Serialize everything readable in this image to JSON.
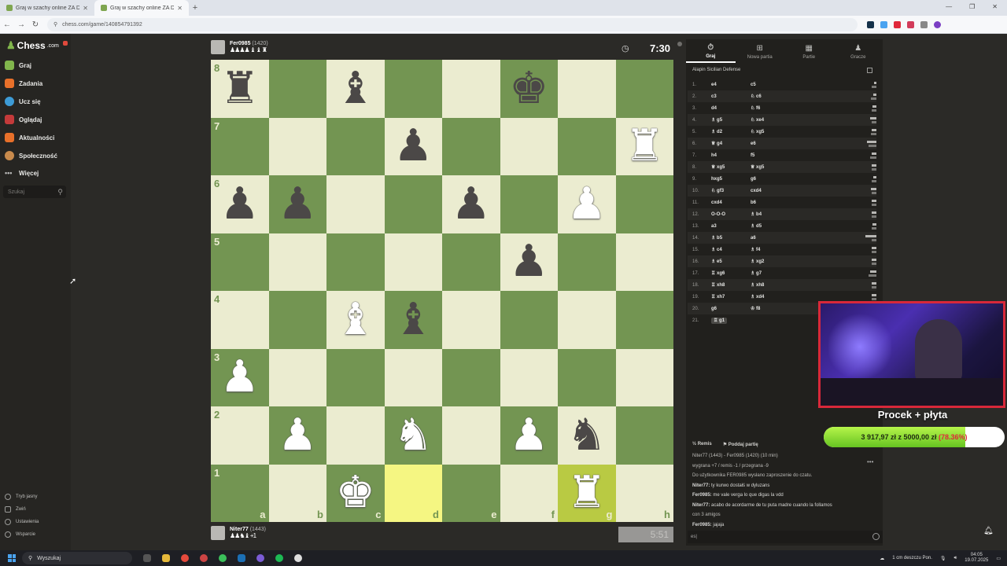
{
  "browser": {
    "tabs": [
      {
        "label": "Graj w szachy online ZA DARMO",
        "active": false
      },
      {
        "label": "Graj w szachy online ZA DARMO",
        "active": true
      }
    ],
    "url": "chess.com/game/140854791392"
  },
  "sidebar": {
    "logo": "Chess",
    "logo_domain": ".com",
    "items": [
      {
        "label": "Graj",
        "icon": "pawn-play-icon",
        "color": "#81b64c"
      },
      {
        "label": "Zadania",
        "icon": "puzzle-icon",
        "color": "#e8702a"
      },
      {
        "label": "Ucz się",
        "icon": "learn-icon",
        "color": "#3d9bd6"
      },
      {
        "label": "Oglądaj",
        "icon": "watch-icon",
        "color": "#c43a3a"
      },
      {
        "label": "Aktualności",
        "icon": "news-icon",
        "color": "#e8702a"
      },
      {
        "label": "Społeczność",
        "icon": "community-icon",
        "color": "#c88a4c"
      },
      {
        "label": "Więcej",
        "icon": "more-icon",
        "color": "#9a9a98"
      }
    ],
    "search_placeholder": "Szukaj",
    "bottom": [
      {
        "label": "Tryb jasny"
      },
      {
        "label": "Zwiń"
      },
      {
        "label": "Ustawienia"
      },
      {
        "label": "Wsparcie"
      }
    ]
  },
  "top_player": {
    "name": "Fer0985",
    "rating": "(1420)",
    "captured": "♟♟♟♟ ♝ ♝ ♜",
    "clock": "7:30"
  },
  "bottom_player": {
    "name": "Niter77",
    "rating": "(1443)",
    "captured": "♟♟♞♝ +1",
    "clock": "5:51"
  },
  "board": {
    "ranks": [
      "8",
      "7",
      "6",
      "5",
      "4",
      "3",
      "2",
      "1"
    ],
    "files": [
      "a",
      "b",
      "c",
      "d",
      "e",
      "f",
      "g",
      "h"
    ],
    "highlight": [
      "d1",
      "g1"
    ],
    "position": [
      [
        "br",
        "",
        "bb",
        "",
        "",
        "bk",
        "",
        ""
      ],
      [
        "",
        "",
        "",
        "bp",
        "",
        "",
        "",
        "wr"
      ],
      [
        "bp",
        "bp",
        "",
        "",
        "bp",
        "",
        "wp",
        ""
      ],
      [
        "",
        "",
        "",
        "",
        "",
        "bp",
        "",
        ""
      ],
      [
        "",
        "",
        "wb",
        "bb",
        "",
        "",
        "",
        ""
      ],
      [
        "wp",
        "",
        "",
        "",
        "",
        "",
        "",
        ""
      ],
      [
        "",
        "wp",
        "",
        "wn",
        "",
        "wp",
        "bn",
        ""
      ],
      [
        "",
        "",
        "wk",
        "",
        "",
        "",
        "wr",
        ""
      ]
    ]
  },
  "right_panel": {
    "tabs": [
      {
        "label": "Graj",
        "icon": "clock-icon",
        "active": true
      },
      {
        "label": "Nowa partia",
        "icon": "plus-icon",
        "active": false
      },
      {
        "label": "Partie",
        "icon": "games-icon",
        "active": false
      },
      {
        "label": "Gracze",
        "icon": "players-icon",
        "active": false
      }
    ],
    "opening": "Alapin Sicilian Defense",
    "moves": [
      {
        "n": "1.",
        "w": "e4",
        "b": "c5",
        "tw": 0.15,
        "tb": 0.3
      },
      {
        "n": "2.",
        "w": "c3",
        "b": "♘ c6",
        "tw": 0.2,
        "tb": 0.35
      },
      {
        "n": "3.",
        "w": "d4",
        "b": "♘ f6",
        "tw": 0.25,
        "tb": 0.3
      },
      {
        "n": "4.",
        "w": "♗ g5",
        "b": "♘ xe4",
        "tw": 0.4,
        "tb": 0.3
      },
      {
        "n": "5.",
        "w": "♗ d2",
        "b": "♘ xg5",
        "tw": 0.3,
        "tb": 0.35
      },
      {
        "n": "6.",
        "w": "♕ g4",
        "b": "e6",
        "tw": 0.6,
        "tb": 0.5
      },
      {
        "n": "7.",
        "w": "h4",
        "b": "f5",
        "tw": 0.3,
        "tb": 0.4
      },
      {
        "n": "8.",
        "w": "♕ xg5",
        "b": "♕ xg5",
        "tw": 0.3,
        "tb": 0.3
      },
      {
        "n": "9.",
        "w": "hxg5",
        "b": "g6",
        "tw": 0.2,
        "tb": 0.3
      },
      {
        "n": "10.",
        "w": "♘ gf3",
        "b": "cxd4",
        "tw": 0.35,
        "tb": 0.3
      },
      {
        "n": "11.",
        "w": "cxd4",
        "b": "b6",
        "tw": 0.3,
        "tb": 0.3
      },
      {
        "n": "12.",
        "w": "O-O-O",
        "b": "♗ b4",
        "tw": 0.3,
        "tb": 0.3
      },
      {
        "n": "13.",
        "w": "a3",
        "b": "♗ d5",
        "tw": 0.25,
        "tb": 0.3
      },
      {
        "n": "14.",
        "w": "♗ b5",
        "b": "a6",
        "tw": 0.7,
        "tb": 0.3
      },
      {
        "n": "15.",
        "w": "♗ c4",
        "b": "♗ f4",
        "tw": 0.3,
        "tb": 0.3
      },
      {
        "n": "16.",
        "w": "♗ e5",
        "b": "♗ xg2",
        "tw": 0.3,
        "tb": 0.3
      },
      {
        "n": "17.",
        "w": "♖ xg6",
        "b": "♗ g7",
        "tw": 0.4,
        "tb": 0.5
      },
      {
        "n": "18.",
        "w": "♖ xh8",
        "b": "♗ xh8",
        "tw": 0.3,
        "tb": 0.3
      },
      {
        "n": "19.",
        "w": "♖ xh7",
        "b": "♗ xd4",
        "tw": 0.3,
        "tb": 0.3
      },
      {
        "n": "20.",
        "w": "g6",
        "b": "♔ f8",
        "tw": 0.3,
        "tb": 0.3
      },
      {
        "n": "21.",
        "w": "♖ g1",
        "b": "",
        "tw": 0,
        "tb": 0,
        "current": true
      }
    ],
    "actions": [
      {
        "label": "Remis",
        "icon": "draw-icon"
      },
      {
        "label": "Poddaj partię",
        "icon": "resign-flag-icon"
      }
    ],
    "chat": [
      {
        "type": "sys",
        "text": "Niter77 (1443) - Fer0985 (1420) (10 min)"
      },
      {
        "type": "sys",
        "text": "wygrana +7 / remis -1 / przegrana -9"
      },
      {
        "type": "sys",
        "text": "Do użytkownika FER0985 wysłano zaproszenie do czatu."
      },
      {
        "type": "msg",
        "user": "Niter77:",
        "text": " ty kurwo dostałś w dyluzans"
      },
      {
        "type": "msg",
        "user": "Fer0985:",
        "text": " me vale verga lo que digas la vdd"
      },
      {
        "type": "msg",
        "user": "Niter77:",
        "text": " acabo de acordarme de tu puta madre cuando la follamos"
      },
      {
        "type": "sys",
        "text": "con 3 amigos"
      },
      {
        "type": "msg",
        "user": "Fer0985:",
        "text": " jajaja"
      }
    ],
    "chat_input": "es|"
  },
  "stream": {
    "goal_title": "Procek + płyta",
    "goal_text": "3 917,97 zł z 5000,00 zł",
    "goal_pct": "(78.36%)",
    "goal_fraction": 0.7836,
    "border_color": "#d8283a"
  },
  "taskbar": {
    "search": "Wyszukaj",
    "weather": "1 cm deszczu Pon.",
    "time": "04:05",
    "date": "19.07.2025"
  }
}
